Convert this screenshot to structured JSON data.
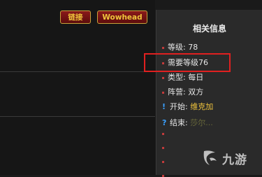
{
  "toolbar": {
    "link_label": "链接",
    "wowhead_label": "Wowhead"
  },
  "panel": {
    "title": "相关信息",
    "rows": [
      {
        "label": "等级: 78"
      },
      {
        "label": "需要等级76"
      },
      {
        "label": "类型: 每日"
      },
      {
        "label": "阵营: 双方"
      },
      {
        "label_prefix": "开始: ",
        "value": "维克加"
      },
      {
        "label_prefix": "结束: ",
        "value": "莎尔..."
      }
    ]
  },
  "watermark": {
    "text": "九游",
    "icon": "jiuyou-logo-icon"
  },
  "colors": {
    "accent_gold": "#f0c43c",
    "button_red": "#7a1414",
    "highlight_red": "#e02020",
    "bullet_red": "#c23b3b",
    "quest_blue": "#3aa0ff"
  }
}
